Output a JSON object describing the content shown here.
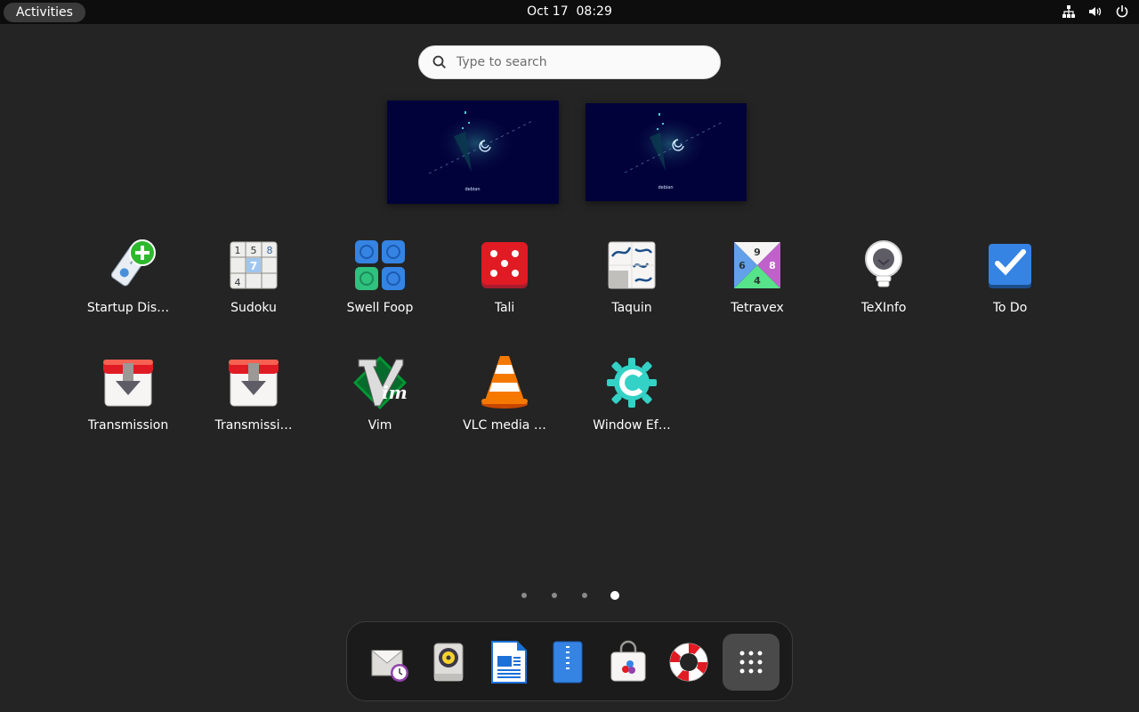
{
  "topbar": {
    "activities_label": "Activities",
    "clock": "Oct 17  08:29",
    "status_icons": [
      "network-icon",
      "volume-icon",
      "power-icon"
    ]
  },
  "search": {
    "placeholder": "Type to search"
  },
  "workspaces": [
    {
      "name": "workspace-1",
      "wallpaper_text": "debian"
    },
    {
      "name": "workspace-2",
      "wallpaper_text": "debian"
    }
  ],
  "apps": [
    {
      "label": "Startup Dis…",
      "icon": "usb-creator-icon"
    },
    {
      "label": "Sudoku",
      "icon": "sudoku-icon"
    },
    {
      "label": "Swell Foop",
      "icon": "swell-foop-icon"
    },
    {
      "label": "Tali",
      "icon": "tali-dice-icon"
    },
    {
      "label": "Taquin",
      "icon": "taquin-icon"
    },
    {
      "label": "Tetravex",
      "icon": "tetravex-icon"
    },
    {
      "label": "TeXInfo",
      "icon": "texinfo-lightbulb-icon"
    },
    {
      "label": "To Do",
      "icon": "todo-checkbox-icon"
    },
    {
      "label": "Transmission",
      "icon": "transmission-icon"
    },
    {
      "label": "Transmissi…",
      "icon": "transmission-icon"
    },
    {
      "label": "Vim",
      "icon": "vim-icon"
    },
    {
      "label": "VLC media …",
      "icon": "vlc-cone-icon"
    },
    {
      "label": "Window Ef…",
      "icon": "window-effects-icon"
    }
  ],
  "sudoku_digits": [
    "1",
    "5",
    "8",
    "7",
    "4"
  ],
  "tetravex_digits": [
    "9",
    "6",
    "8",
    "4"
  ],
  "vim_text": "im",
  "pagination": {
    "pages": 4,
    "current_page": 4
  },
  "dock": [
    "evolution-mail-icon",
    "rhythmbox-icon",
    "libreoffice-writer-icon",
    "file-archive-icon",
    "software-store-icon",
    "help-lifebuoy-icon",
    "show-apps-grid-icon"
  ]
}
